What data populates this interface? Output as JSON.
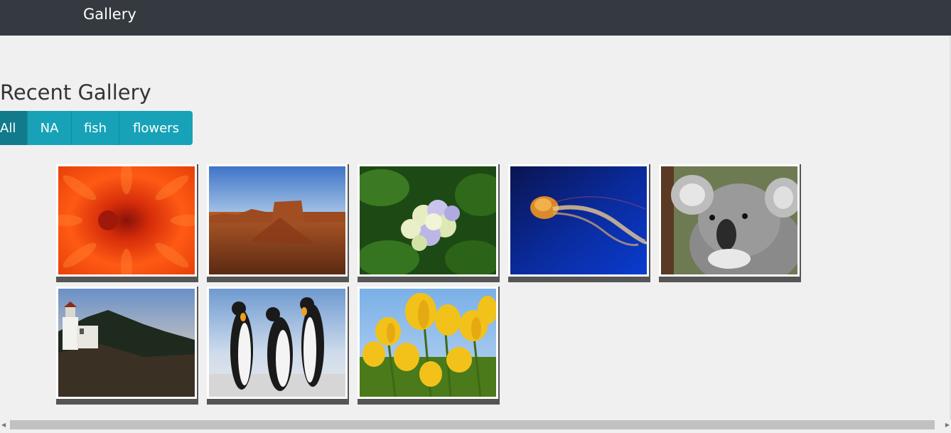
{
  "navbar": {
    "brand": "Gallery"
  },
  "section": {
    "title": "Recent Gallery"
  },
  "filters": [
    {
      "label": "All",
      "active": true
    },
    {
      "label": "NA",
      "active": false
    },
    {
      "label": "fish",
      "active": false
    },
    {
      "label": "flowers",
      "active": false
    }
  ],
  "gallery": {
    "items": [
      {
        "subject": "chrysanthemum"
      },
      {
        "subject": "desert"
      },
      {
        "subject": "hydrangeas"
      },
      {
        "subject": "jellyfish"
      },
      {
        "subject": "koala"
      },
      {
        "subject": "lighthouse"
      },
      {
        "subject": "penguins"
      },
      {
        "subject": "tulips"
      }
    ]
  },
  "colors": {
    "navbar": "#343a40",
    "accent": "#17a2b8",
    "accent_active": "#117a8b",
    "background": "#f0f0f0"
  }
}
